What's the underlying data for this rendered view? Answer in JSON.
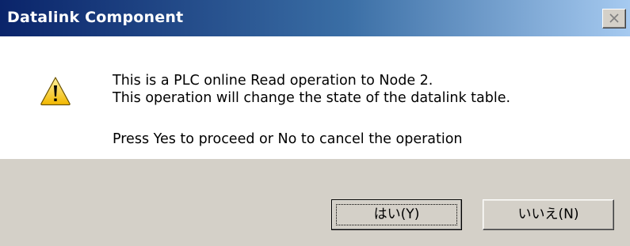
{
  "window": {
    "title": "Datalink Component"
  },
  "titlebar": {
    "close_icon": "close-icon"
  },
  "message": {
    "icon": "warning-icon",
    "line1": "This is a PLC online Read operation to Node 2.",
    "line2": "This operation will change the state of the datalink table.",
    "line3": "Press Yes to proceed or No to cancel the operation"
  },
  "buttons": {
    "yes_label": "はい(Y)",
    "no_label": "いいえ(N)"
  },
  "colors": {
    "titlebar_start": "#0a246a",
    "titlebar_end": "#a6caf0",
    "button_face": "#d4d0c8",
    "icon_yellow": "#f2c200"
  }
}
